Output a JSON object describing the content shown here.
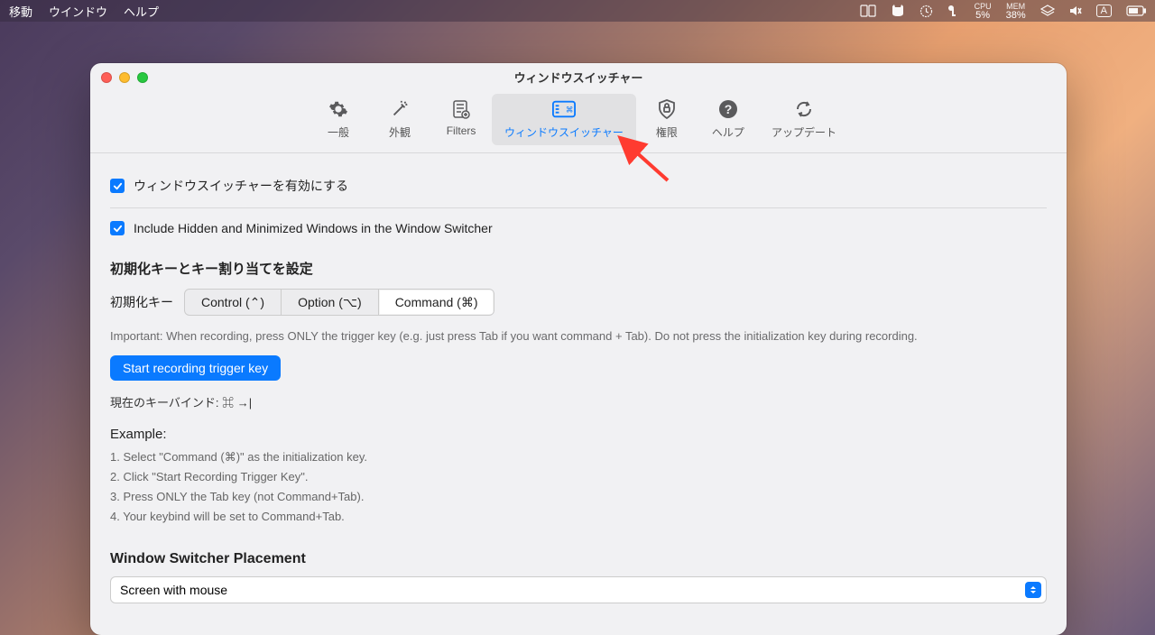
{
  "menubar": {
    "left": [
      "移動",
      "ウインドウ",
      "ヘルプ"
    ],
    "stats": [
      {
        "label": "CPU",
        "value": "5%"
      },
      {
        "label": "MEM",
        "value": "38%"
      }
    ],
    "input_badge": "A"
  },
  "window": {
    "title": "ウィンドウスイッチャー",
    "tabs": [
      {
        "icon": "gear",
        "label": "一般"
      },
      {
        "icon": "wand",
        "label": "外観"
      },
      {
        "icon": "filter",
        "label": "Filters"
      },
      {
        "icon": "switcher",
        "label": "ウィンドウスイッチャー",
        "active": true
      },
      {
        "icon": "shield",
        "label": "権限"
      },
      {
        "icon": "help",
        "label": "ヘルプ"
      },
      {
        "icon": "update",
        "label": "アップデート"
      }
    ]
  },
  "settings": {
    "enable_label": "ウィンドウスイッチャーを有効にする",
    "include_hidden_label": "Include Hidden and Minimized Windows in the Window Switcher",
    "init_section_head": "初期化キーとキー割り当てを設定",
    "init_key_label": "初期化キー",
    "seg_options": [
      "Control (⌃)",
      "Option (⌥)",
      "Command (⌘)"
    ],
    "seg_selected": 2,
    "important_note": "Important: When recording, press ONLY the trigger key (e.g. just press Tab if you want command + Tab). Do not press the initialization key during recording.",
    "record_button": "Start recording trigger key",
    "current_keybind_prefix": "現在のキーバインド: ",
    "current_keybind_value": "⌘ →|",
    "example_head": "Example:",
    "example_steps": [
      "1. Select \"Command (⌘)\" as the initialization key.",
      "2. Click \"Start Recording Trigger Key\".",
      "3. Press ONLY the Tab key (not Command+Tab).",
      "4. Your keybind will be set to Command+Tab."
    ],
    "placement_head": "Window Switcher Placement",
    "placement_options": [
      "Screen with mouse"
    ],
    "placement_selected": "Screen with mouse"
  }
}
